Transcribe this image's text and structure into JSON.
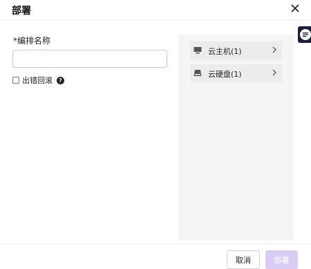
{
  "dialog": {
    "title": "部署"
  },
  "form": {
    "name_label": "*编排名称",
    "name_value": "",
    "name_placeholder": "",
    "rollback_label": "出错回滚",
    "rollback_checked": false,
    "help_icon_glyph": "?"
  },
  "resources": [
    {
      "label": "云主机(1)",
      "icon": "monitor-icon"
    },
    {
      "label": "云硬盘(1)",
      "icon": "disk-icon"
    }
  ],
  "footer": {
    "cancel_label": "取消",
    "deploy_label": "部署"
  },
  "colors": {
    "deploy_disabled_bg": "#d9cdf8",
    "panel_bg": "#f5f5f5",
    "side_button_bg": "#1c1c3c"
  }
}
